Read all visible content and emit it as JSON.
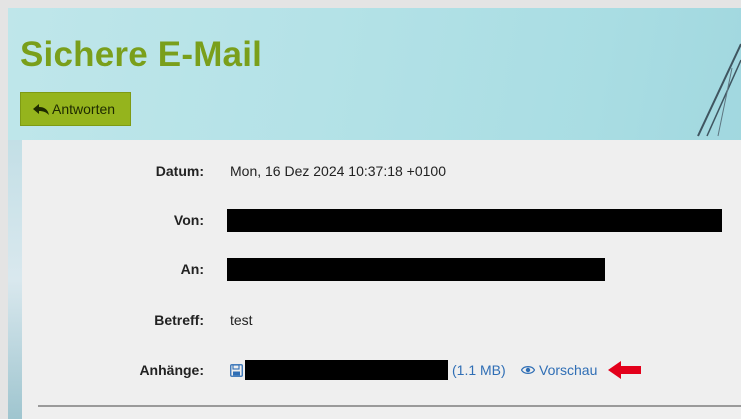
{
  "header": {
    "title": "Sichere E-Mail",
    "reply_label": "Antworten"
  },
  "details": {
    "date_label": "Datum:",
    "date_value": "Mon, 16 Dez 2024 10:37:18 +0100",
    "from_label": "Von:",
    "to_label": "An:",
    "subject_label": "Betreff:",
    "subject_value": "test",
    "attachments_label": "Anhänge:",
    "attachment_size": "(1.1 MB)",
    "preview_label": "Vorschau"
  },
  "colors": {
    "title": "#7a9f1b",
    "button": "#95b41d",
    "link": "#2f6eb5",
    "arrow": "#e3001b"
  },
  "icons": {
    "reply": "reply-arrow-icon",
    "save": "floppy-disk-icon",
    "preview": "eye-icon",
    "annotation": "red-arrow-icon"
  }
}
